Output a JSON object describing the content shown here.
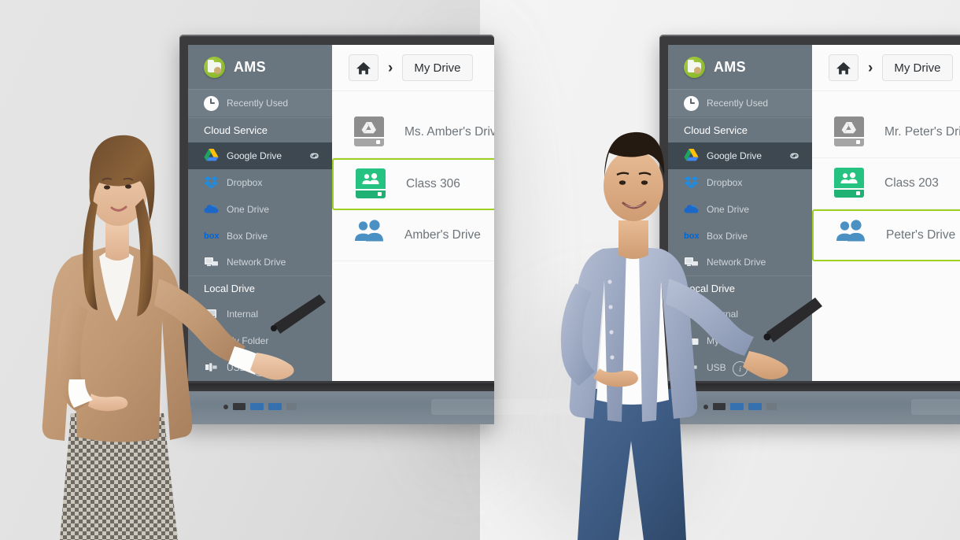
{
  "scene": {
    "description": "Two interactive whiteboard displays showing the AMS file manager app",
    "wall_color_left": "#e3e3e3",
    "wall_color_right": "#f2f2f2",
    "accent_green": "#9ed020",
    "logo_green": "#8dbb2e",
    "class_icon_green": "#26c281",
    "people_icon_blue": "#4a90c2"
  },
  "screens": [
    {
      "id": "left-display",
      "sidebar": {
        "app_title": "AMS",
        "logo_icon": "ams-folder-touch-icon",
        "recent": {
          "label": "Recently Used",
          "icon": "clock-icon"
        },
        "sections": [
          {
            "title": "Cloud Service",
            "items": [
              {
                "label": "Google Drive",
                "icon": "google-drive-icon",
                "active": true,
                "trailing_icon": "link-icon"
              },
              {
                "label": "Dropbox",
                "icon": "dropbox-icon",
                "active": false
              },
              {
                "label": "One Drive",
                "icon": "onedrive-icon",
                "active": false
              },
              {
                "label": "Box Drive",
                "icon": "box-icon",
                "active": false
              },
              {
                "label": "Network Drive",
                "icon": "network-drive-icon",
                "active": false
              }
            ]
          },
          {
            "title": "Local Drive",
            "items": [
              {
                "label": "Internal",
                "icon": "internal-drive-icon",
                "active": false
              },
              {
                "label": "My Folder",
                "icon": "folder-icon",
                "active": false
              },
              {
                "label": "USB",
                "icon": "usb-icon",
                "active": false
              }
            ]
          }
        ],
        "footer_icon": "info-icon",
        "footer_icon_glyph": "i"
      },
      "breadcrumb": {
        "home_icon": "home-icon",
        "separator": "›",
        "current": "My Drive"
      },
      "files": [
        {
          "name": "Ms. Amber's Drive",
          "icon": "google-drive-disk-icon",
          "icon_style": "grey-drive",
          "selected": false
        },
        {
          "name": "Class 306",
          "icon": "shared-class-drive-icon",
          "icon_style": "green-drive",
          "selected": true
        },
        {
          "name": "Amber's Drive",
          "icon": "people-icon",
          "icon_style": "blue-people",
          "selected": false
        }
      ]
    },
    {
      "id": "right-display",
      "sidebar": {
        "app_title": "AMS",
        "logo_icon": "ams-folder-touch-icon",
        "recent": {
          "label": "Recently Used",
          "icon": "clock-icon"
        },
        "sections": [
          {
            "title": "Cloud Service",
            "items": [
              {
                "label": "Google Drive",
                "icon": "google-drive-icon",
                "active": true,
                "trailing_icon": "link-icon"
              },
              {
                "label": "Dropbox",
                "icon": "dropbox-icon",
                "active": false
              },
              {
                "label": "One Drive",
                "icon": "onedrive-icon",
                "active": false
              },
              {
                "label": "Box Drive",
                "icon": "box-icon",
                "active": false
              },
              {
                "label": "Network Drive",
                "icon": "network-drive-icon",
                "active": false
              }
            ]
          },
          {
            "title": "Local Drive",
            "items": [
              {
                "label": "Internal",
                "icon": "internal-drive-icon",
                "active": false
              },
              {
                "label": "My Folder",
                "icon": "folder-icon",
                "active": false
              },
              {
                "label": "USB",
                "icon": "usb-icon",
                "active": false
              }
            ]
          }
        ],
        "footer_icon": "info-icon",
        "footer_icon_glyph": "i"
      },
      "breadcrumb": {
        "home_icon": "home-icon",
        "separator": "›",
        "current": "My Drive"
      },
      "files": [
        {
          "name": "Mr. Peter's Drive",
          "icon": "google-drive-disk-icon",
          "icon_style": "grey-drive",
          "selected": false
        },
        {
          "name": "Class 203",
          "icon": "shared-class-drive-icon",
          "icon_style": "green-drive",
          "selected": false
        },
        {
          "name": "Peter's Drive",
          "icon": "people-icon",
          "icon_style": "blue-people",
          "selected": true
        }
      ]
    }
  ],
  "hardware": {
    "ports": [
      "usb-port",
      "usb3-port",
      "usb3-port",
      "hdmi-port"
    ],
    "speaker_grille": "speaker-grille"
  }
}
